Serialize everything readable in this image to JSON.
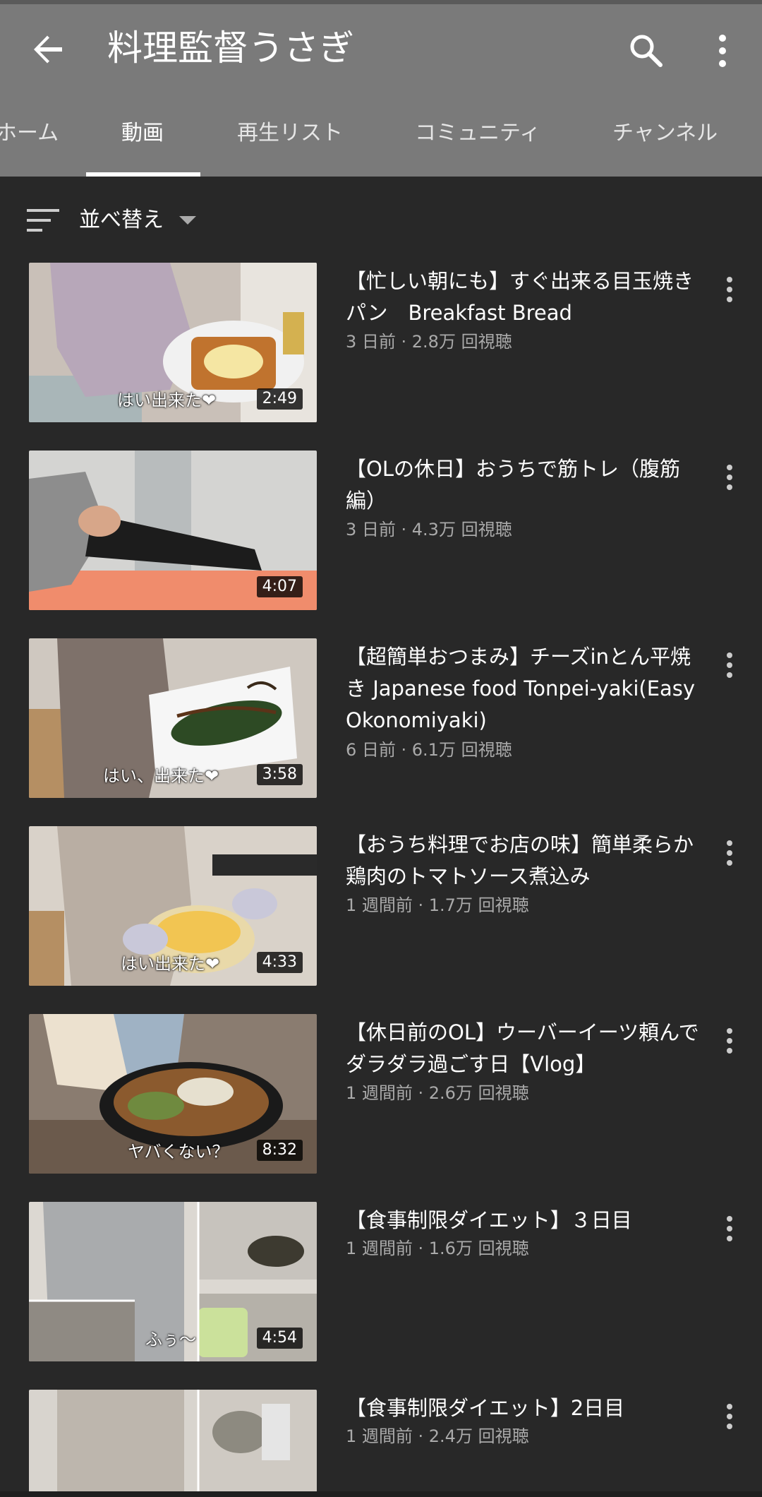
{
  "app_bar": {
    "title": "料理監督うさぎ",
    "back_icon": "arrow-back-icon",
    "search_icon": "search-icon",
    "more_icon": "more-vert-icon"
  },
  "tabs": [
    {
      "label": "ホーム",
      "active": false
    },
    {
      "label": "動画",
      "active": true
    },
    {
      "label": "再生リスト",
      "active": false
    },
    {
      "label": "コミュニティ",
      "active": false
    },
    {
      "label": "チャンネル",
      "active": false
    }
  ],
  "sort": {
    "label": "並べ替え",
    "icon": "sort-icon"
  },
  "videos": [
    {
      "title": "【忙しい朝にも】すぐ出来る目玉焼きパン　Breakfast  Bread",
      "meta": "3 日前 · 2.8万 回視聴",
      "duration": "2:49",
      "caption": "はい出来た❤"
    },
    {
      "title": "【OLの休日】おうちで筋トレ（腹筋編）",
      "meta": "3 日前 · 4.3万 回視聴",
      "duration": "4:07",
      "caption": ""
    },
    {
      "title": "【超簡単おつまみ】チーズinとん平焼き Japanese food Tonpei-yaki(Easy Okonomiyaki)",
      "meta": "6 日前 · 6.1万 回視聴",
      "duration": "3:58",
      "caption": "はい、出来た❤"
    },
    {
      "title": "【おうち料理でお店の味】簡単柔らか鶏肉のトマトソース煮込み",
      "meta": "1 週間前 · 1.7万 回視聴",
      "duration": "4:33",
      "caption": "はい出来た❤"
    },
    {
      "title": "【休日前のOL】ウーバーイーツ頼んでダラダラ過ごす日【Vlog】",
      "meta": "1 週間前 · 2.6万 回視聴",
      "duration": "8:32",
      "caption": "ヤバくない？"
    },
    {
      "title": "【食事制限ダイエット】３日目",
      "meta": "1 週間前 · 1.6万 回視聴",
      "duration": "4:54",
      "caption": "ふぅ〜"
    },
    {
      "title": "【食事制限ダイエット】2日目",
      "meta": "1 週間前 · 2.4万 回視聴",
      "duration": "",
      "caption": ""
    }
  ],
  "colors": {
    "app_bar": "#7a7a7a",
    "background": "#282828",
    "meta_text": "#aaaaaa"
  }
}
